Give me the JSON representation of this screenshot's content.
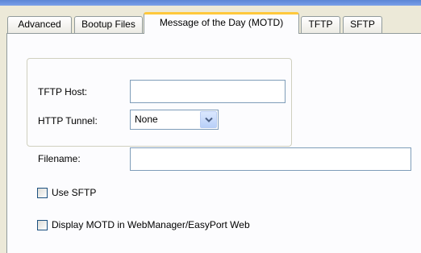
{
  "tabs": [
    {
      "label": "Advanced",
      "active": false
    },
    {
      "label": "Bootup Files",
      "active": false
    },
    {
      "label": "Message of the Day (MOTD)",
      "active": true
    },
    {
      "label": "TFTP",
      "active": false
    },
    {
      "label": "SFTP",
      "active": false
    }
  ],
  "form": {
    "tftp_host_label": "TFTP Host:",
    "tftp_host_value": "",
    "http_tunnel_label": "HTTP Tunnel:",
    "http_tunnel_value": "None",
    "filename_label": "Filename:",
    "filename_value": "",
    "use_sftp_label": "Use SFTP",
    "use_sftp_checked": false,
    "display_motd_label": "Display MOTD in WebManager/EasyPort Web",
    "display_motd_checked": false
  },
  "colors": {
    "dialog_bg": "#ece9d8",
    "panel_bg": "#fcfcfe",
    "active_tab_accent": "#ffc83c",
    "border": "#919b9c",
    "input_border": "#7f9db9"
  },
  "icons": {
    "dropdown": "chevron-down-icon"
  }
}
